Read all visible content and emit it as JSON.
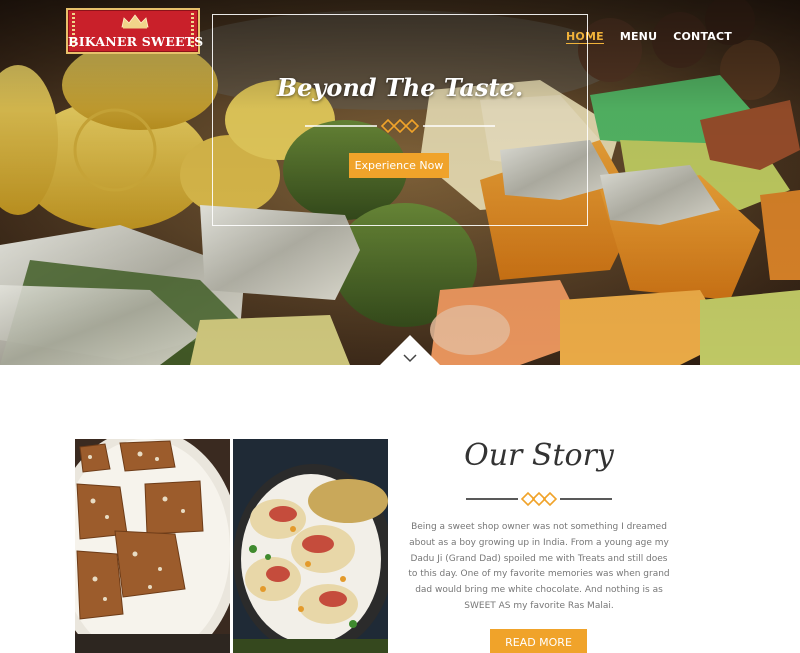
{
  "brand": {
    "name": "BIKANER SWEETS"
  },
  "nav": {
    "items": [
      "HOME",
      "MENU",
      "CONTACT"
    ],
    "active": "HOME"
  },
  "hero": {
    "title": "Beyond The Taste.",
    "cta_label": "Experience Now"
  },
  "story": {
    "title": "Our Story",
    "text": "Being a sweet shop owner was not something I dreamed about as a boy growing up in India. From a young age my Dadu Ji (Grand Dad) spoiled me with Treats and still does to this day. One of my favorite memories was when grand dad would bring me white chocolate. And nothing is as SWEET AS my favorite Ras Malai.",
    "button_label": "READ MORE"
  },
  "colors": {
    "accent": "#f0a32a",
    "logo_red": "#c9202a",
    "nav_active": "#f0b23a",
    "text_muted": "#777777",
    "heading": "#333333"
  },
  "icons": [
    "crown-icon",
    "diamond-divider-icon",
    "chevron-down-icon"
  ]
}
